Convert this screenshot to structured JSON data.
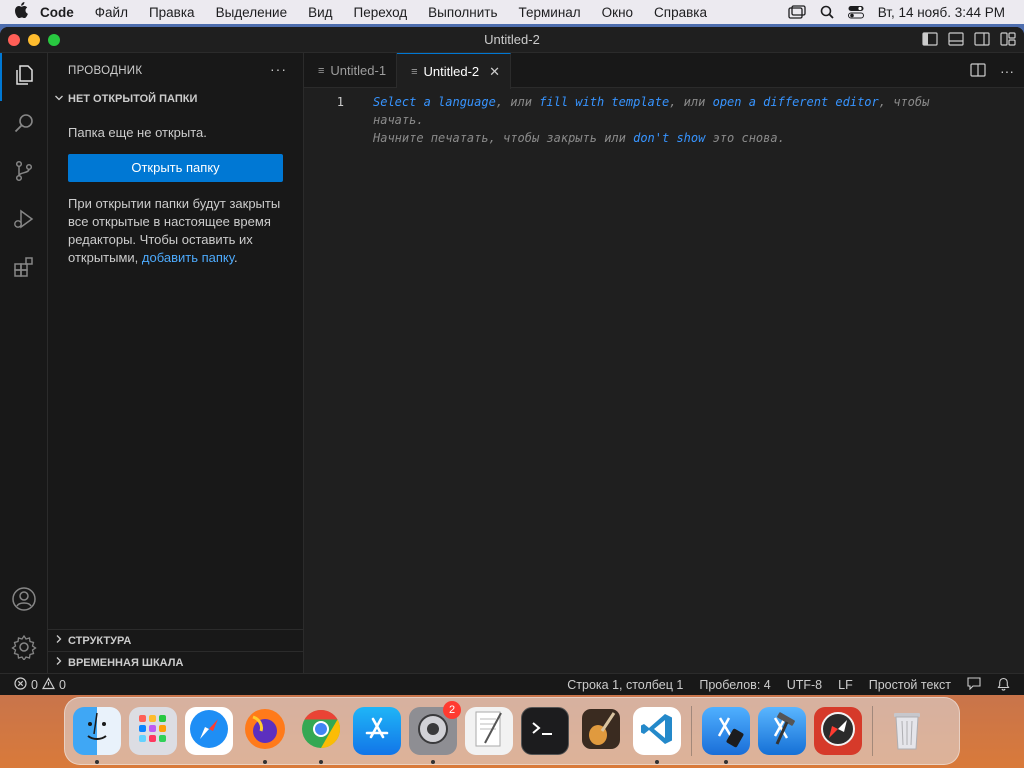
{
  "menubar": {
    "apple_icon": "apple-logo",
    "items": [
      "Code",
      "Файл",
      "Правка",
      "Выделение",
      "Вид",
      "Переход",
      "Выполнить",
      "Терминал",
      "Окно",
      "Справка"
    ],
    "clock": "Вт, 14 нояб. 3:44 PM"
  },
  "window": {
    "title": "Untitled-2"
  },
  "sidebar": {
    "title": "ПРОВОДНИК",
    "more_label": "···",
    "section_title": "НЕТ ОТКРЫТОЙ ПАПКИ",
    "no_folder_text": "Папка еще не открыта.",
    "open_folder_button": "Открыть папку",
    "info_text": "При открытии папки будут закрыты все открытые в настоящее время редакторы. Чтобы оставить их открытыми, ",
    "add_folder_link": "добавить папку",
    "info_end": ".",
    "outline_title": "СТРУКТУРА",
    "timeline_title": "ВРЕМЕННАЯ ШКАЛА"
  },
  "tabs": [
    {
      "label": "Untitled-1",
      "active": false
    },
    {
      "label": "Untitled-2",
      "active": true
    }
  ],
  "editor": {
    "line_number": "1",
    "hint_select_language": "Select a language",
    "hint_sep1": ", или ",
    "hint_fill_template": "fill with template",
    "hint_sep2": ", или ",
    "hint_open_editor": "open a different editor",
    "hint_tail1": ", чтобы",
    "hint_line2": "начать.",
    "hint_line3_start": "Начните печатать, чтобы закрыть или ",
    "hint_dont_show": "don't show",
    "hint_line3_end": " это снова."
  },
  "statusbar": {
    "errors": "0",
    "warnings": "0",
    "position": "Строка 1, столбец 1",
    "spaces": "Пробелов: 4",
    "encoding": "UTF-8",
    "eol": "LF",
    "language": "Простой текст"
  },
  "dock": {
    "apps": [
      "finder",
      "launchpad",
      "safari",
      "firefox",
      "chrome",
      "app-store",
      "system-settings",
      "textedit",
      "terminal",
      "garageband",
      "vscode",
      "xcode-instruments",
      "xcode",
      "compass",
      "trash"
    ],
    "settings_badge": "2"
  },
  "colors": {
    "accent": "#0078d4",
    "link": "#4daafc",
    "editor_bg": "#1f1f1f",
    "sidebar_bg": "#181818"
  }
}
